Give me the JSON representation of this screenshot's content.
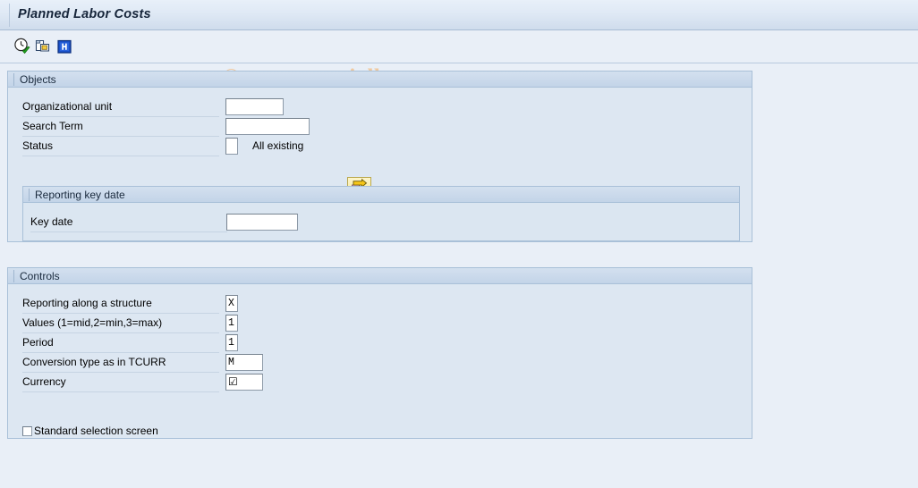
{
  "window": {
    "title": "Planned Labor Costs"
  },
  "toolbar": {
    "buttons": [
      {
        "name": "execute-clock-icon",
        "tooltip": "Execute"
      },
      {
        "name": "copy-icon",
        "tooltip": "Copy"
      },
      {
        "name": "help-icon",
        "tooltip": "Help"
      }
    ]
  },
  "watermark": {
    "text": "© www.tutorialkart.com",
    "color": "#f0c9a0"
  },
  "objects": {
    "header": "Objects",
    "fields": [
      {
        "label": "Organizational unit",
        "value": ""
      },
      {
        "label": "Search Term",
        "value": ""
      },
      {
        "label": "Status",
        "value": ""
      }
    ],
    "status_side_text": "All existing",
    "multi_selection_button": "multi-selection-arrow-icon",
    "keydate": {
      "header": "Reporting key date",
      "label": "Key date",
      "value": ""
    }
  },
  "controls": {
    "header": "Controls",
    "fields": [
      {
        "label": "Reporting along a structure",
        "value": "X"
      },
      {
        "label": "Values (1=mid,2=min,3=max)",
        "value": "1"
      },
      {
        "label": "Period",
        "value": "1"
      },
      {
        "label": "Conversion type as in TCURR",
        "value": "M"
      },
      {
        "label": "Currency",
        "value": "☑"
      }
    ],
    "checkbox": {
      "label": "Standard selection screen",
      "checked": false
    }
  },
  "theme": {
    "background": "#e9eff7",
    "panel_bg": "#dde7f2",
    "panel_border": "#a9c0d8",
    "title_color": "#16253a"
  }
}
